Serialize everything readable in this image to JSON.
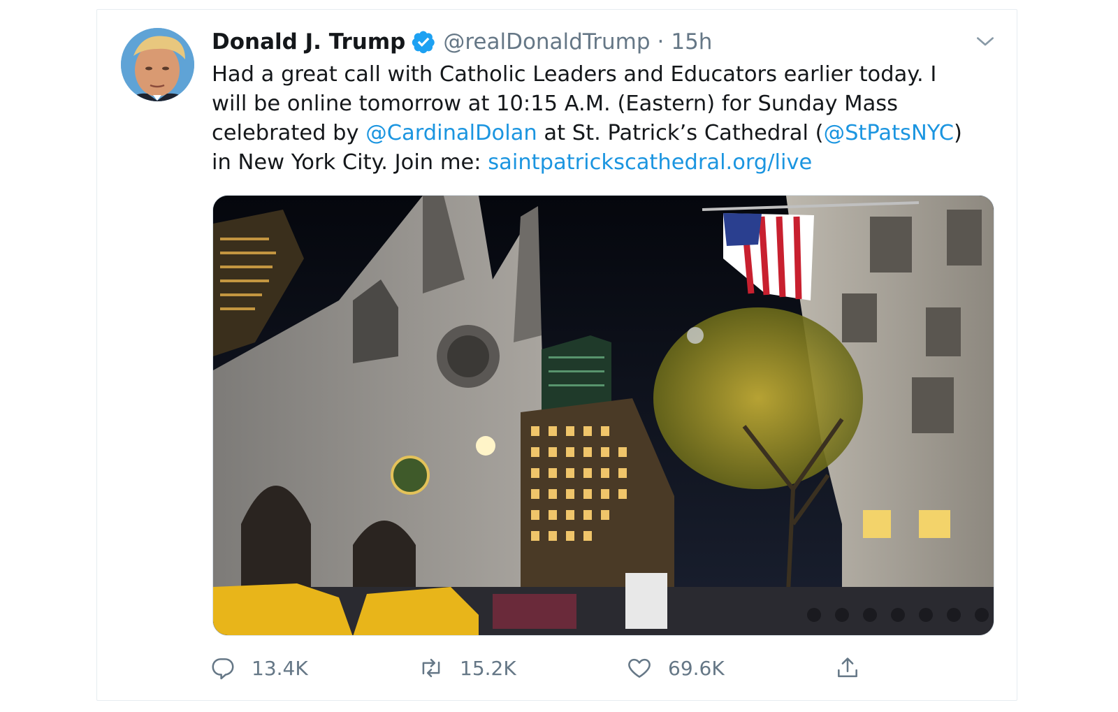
{
  "tweet": {
    "author_name": "Donald J. Trump",
    "handle": "@realDonaldTrump",
    "separator": "·",
    "time": "15h",
    "verified": true,
    "avatar_icon": "profile-photo",
    "lines": [
      [
        {
          "t": "Had a great call with Catholic Leaders and Educators earlier today. I",
          "link": false
        }
      ],
      [
        {
          "t": "will be online tomorrow at 10:15 A.M. (Eastern) for Sunday Mass",
          "link": false
        }
      ],
      [
        {
          "t": "celebrated by ",
          "link": false
        },
        {
          "t": "@CardinalDolan",
          "link": true
        },
        {
          "t": " at St. Patrick’s Cathedral (",
          "link": false
        },
        {
          "t": "@StPatsNYC",
          "link": true
        },
        {
          "t": ")",
          "link": false
        }
      ],
      [
        {
          "t": "in New York City. Join me: ",
          "link": false
        },
        {
          "t": "saintpatrickscathedral.org/live",
          "link": true
        }
      ]
    ],
    "media_icon": "photo-st-patricks-cathedral-night",
    "actions": {
      "reply": {
        "icon": "reply-icon",
        "count": "13.4K"
      },
      "retweet": {
        "icon": "retweet-icon",
        "count": "15.2K"
      },
      "like": {
        "icon": "heart-icon",
        "count": "69.6K"
      },
      "share": {
        "icon": "share-icon"
      }
    },
    "colors": {
      "link": "#1b95e0",
      "muted": "#657786",
      "text": "#14171a",
      "verified": "#1da1f2"
    }
  }
}
